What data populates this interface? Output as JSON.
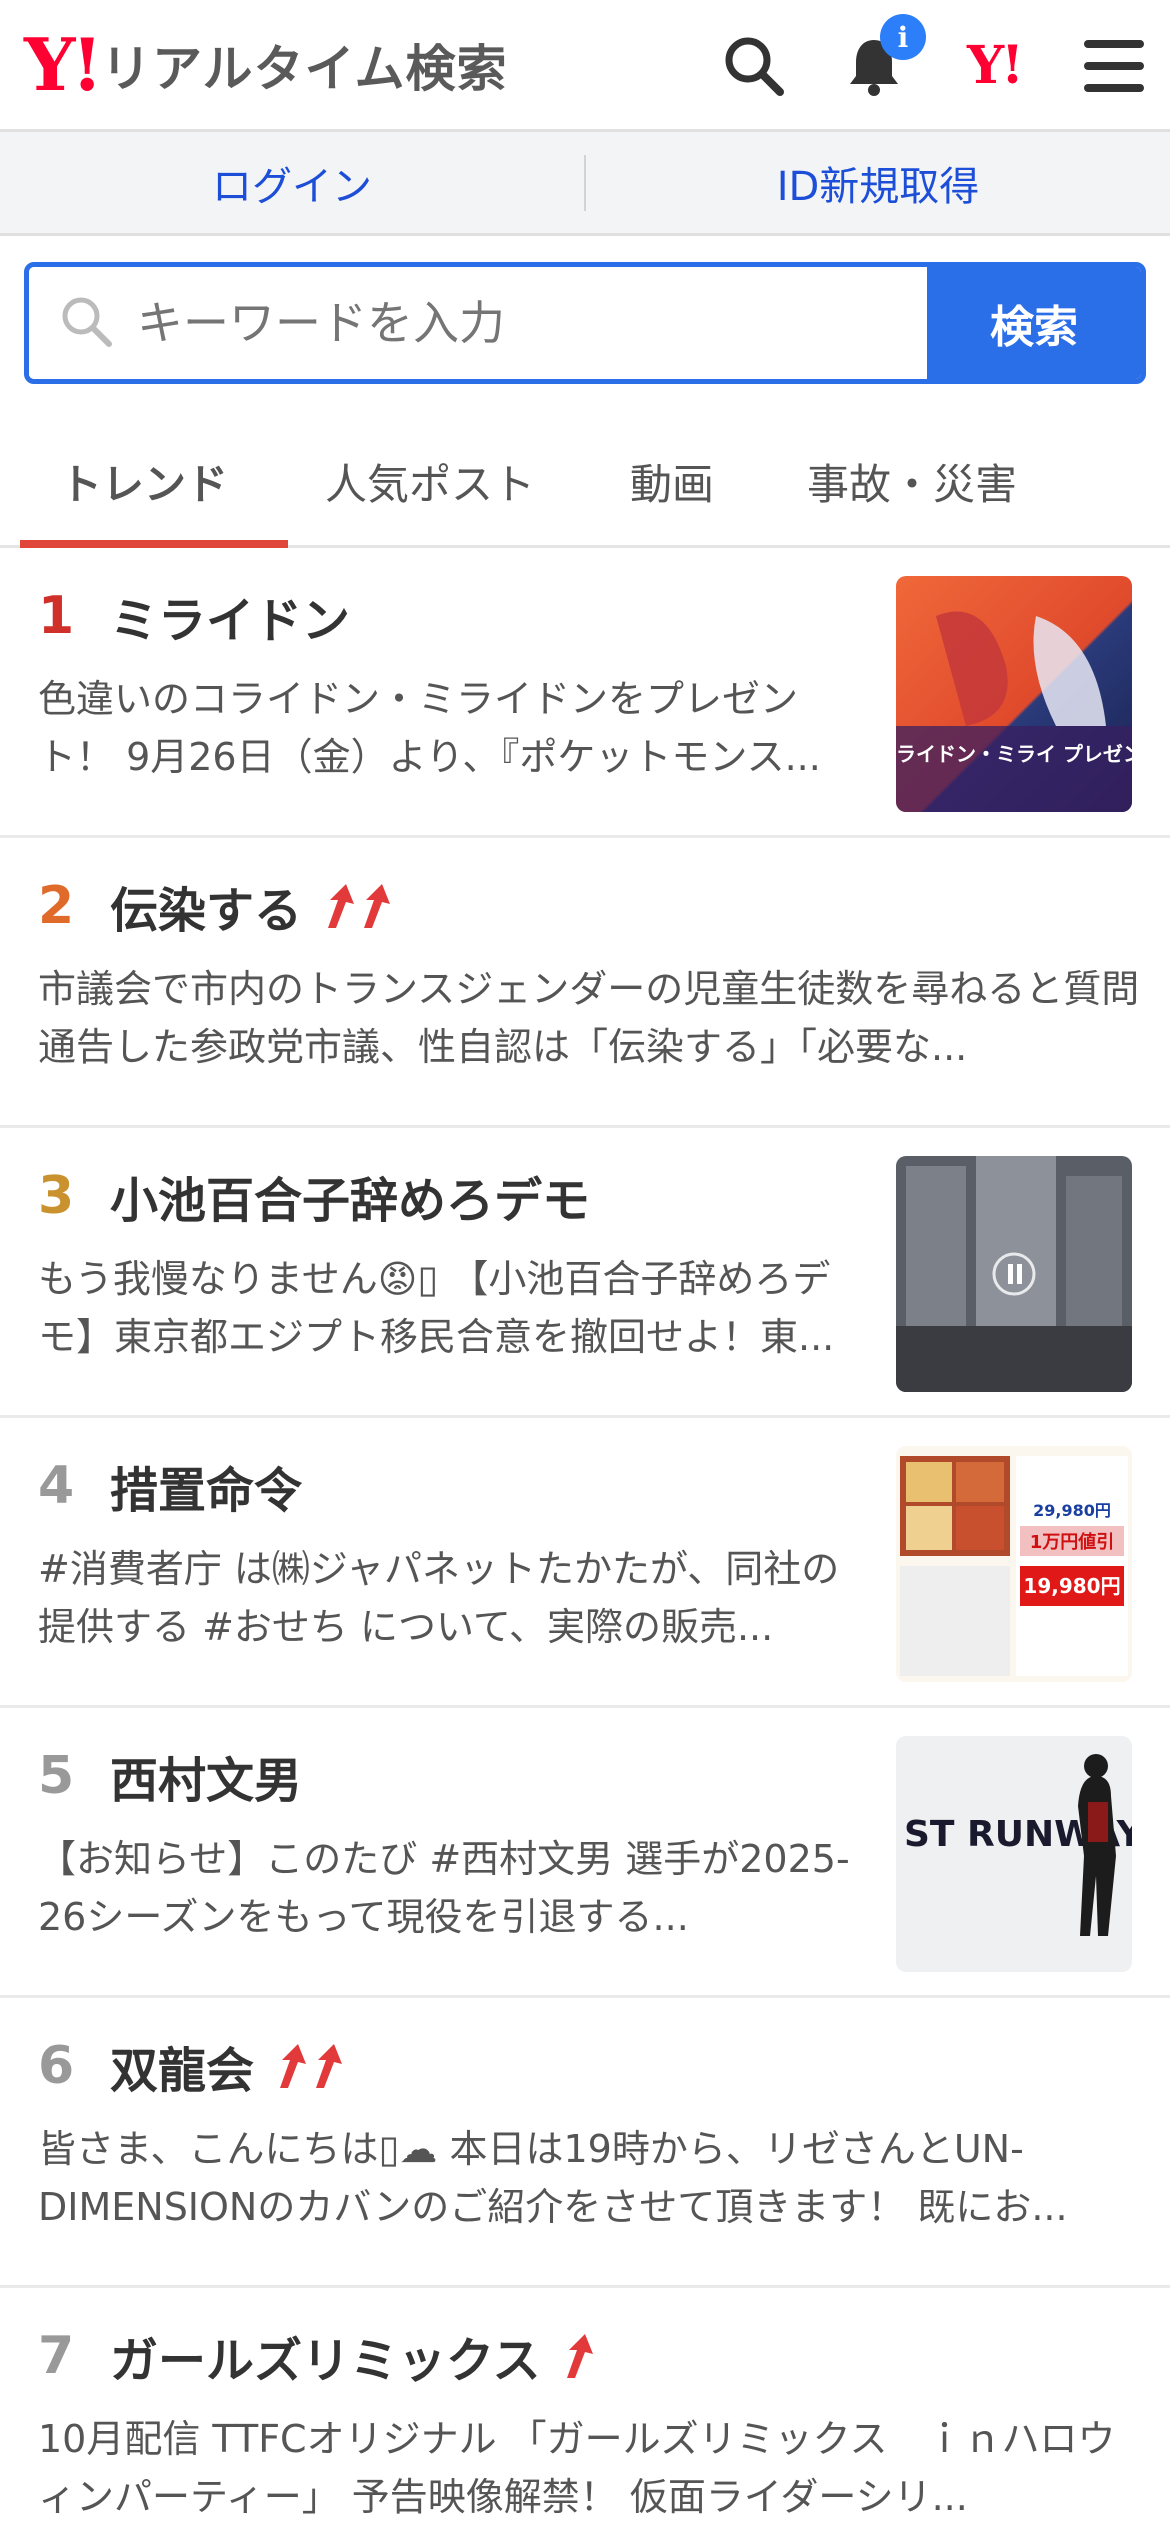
{
  "header": {
    "logo_mark": "Y!",
    "logo_text": "リアルタイム検索",
    "notification_badge": "i",
    "brand_small": "Y!",
    "colors": {
      "brand_red": "#ff0033",
      "accent_blue": "#2a6ee8",
      "badge_blue": "#2d7ff9"
    }
  },
  "auth": {
    "login": "ログイン",
    "signup": "ID新規取得"
  },
  "search": {
    "placeholder": "キーワードを入力",
    "button": "検索"
  },
  "tabs": [
    {
      "label": "トレンド",
      "active": true
    },
    {
      "label": "人気ポスト",
      "active": false
    },
    {
      "label": "動画",
      "active": false
    },
    {
      "label": "事故・災害",
      "active": false
    }
  ],
  "trends": [
    {
      "rank": "1",
      "title": "ミライドン",
      "rank_color": "#d0302a",
      "rising": 0,
      "has_thumb": true,
      "thumb_text": "のコライドン・ミライ プレゼント!",
      "desc": "色違いのコライドン・ミライドンをプレゼント！ 9月26日（金）より、『ポケットモンス..."
    },
    {
      "rank": "2",
      "title": "伝染する",
      "rank_color": "#e06a2a",
      "rising": 2,
      "has_thumb": false,
      "desc": "市議会で市内のトランスジェンダーの児童生徒数を尋ねると質問通告した参政党市議、性自認は「伝染する」「必要な..."
    },
    {
      "rank": "3",
      "title": "小池百合子辞めろデモ",
      "rank_color": "#c9922e",
      "rising": 0,
      "has_thumb": true,
      "desc": "もう我慢なりません😡▯ 【小池百合子辞めろデモ】東京都エジプト移民合意を撤回せよ！東..."
    },
    {
      "rank": "4",
      "title": "措置命令",
      "rank_color": "#999999",
      "rising": 0,
      "has_thumb": true,
      "thumb_text": "29,980円 1万円値引 19,980円",
      "desc": "#消費者庁 は㈱ジャパネットたかたが、同社の提供する #おせち について、実際の販売..."
    },
    {
      "rank": "5",
      "title": "西村文男",
      "rank_color": "#999999",
      "rising": 0,
      "has_thumb": true,
      "thumb_text": "ST RUNWAY",
      "desc": "【お知らせ】このたび #西村文男 選手が2025-26シーズンをもって現役を引退する..."
    },
    {
      "rank": "6",
      "title": "双龍会",
      "rank_color": "#999999",
      "rising": 2,
      "has_thumb": false,
      "desc": "皆さま、こんにちは▯☁ 本日は19時から、リゼさんとUN-DIMENSIONのカバンのご紹介をさせて頂きます！ 既にお..."
    },
    {
      "rank": "7",
      "title": "ガールズリミックス",
      "rank_color": "#999999",
      "rising": 1,
      "has_thumb": false,
      "desc": "10月配信 TTFCオリジナル 「ガールズリミックス　ｉｎハロウィンパーティー」 予告映像解禁！ 仮面ライダーシリ..."
    }
  ]
}
